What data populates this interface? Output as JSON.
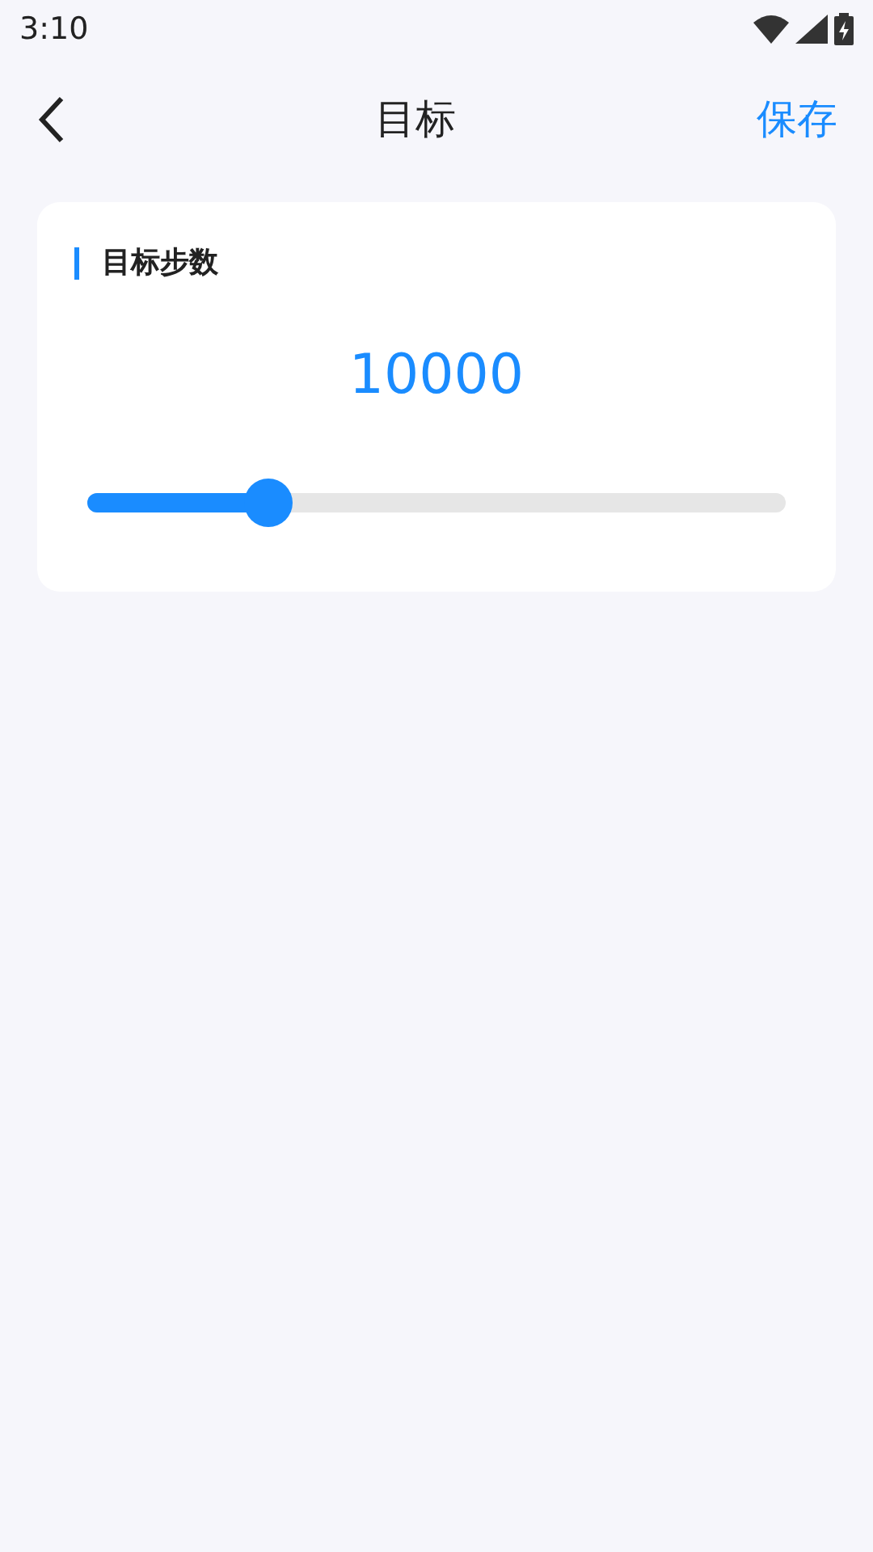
{
  "status_bar": {
    "time": "3:10"
  },
  "header": {
    "title": "目标",
    "action": "保存"
  },
  "card": {
    "title": "目标步数",
    "value": "10000",
    "slider": {
      "level": 0.26
    }
  }
}
